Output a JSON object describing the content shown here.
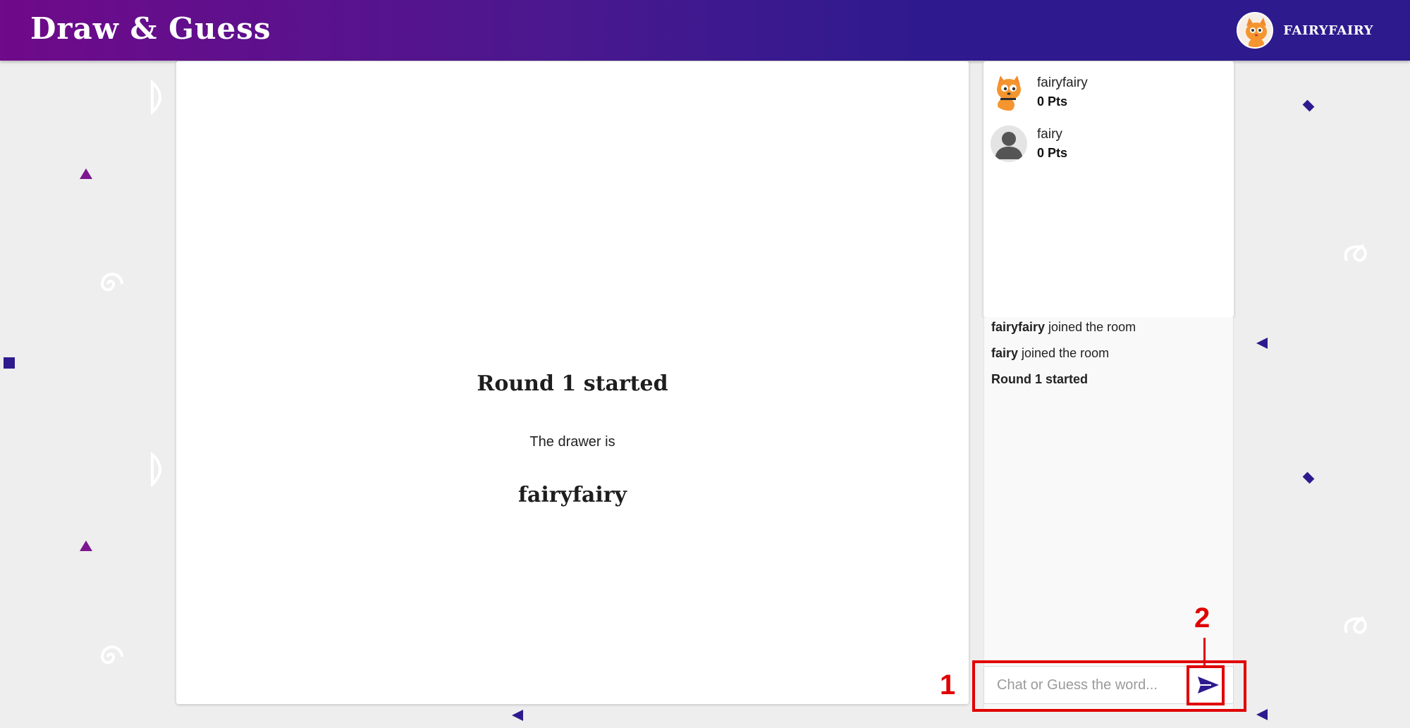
{
  "app": {
    "title": "Draw & Guess",
    "current_user": "FAIRYFAIRY"
  },
  "canvas": {
    "round_title": "Round 1 started",
    "drawer_label": "The drawer is",
    "drawer_name": "fairyfairy"
  },
  "players": [
    {
      "name": "fairyfairy",
      "points": "0 Pts",
      "avatar": "cat-avatar-icon"
    },
    {
      "name": "fairy",
      "points": "0 Pts",
      "avatar": "default-user-icon"
    }
  ],
  "chat": {
    "messages": [
      {
        "bold": "fairyfairy",
        "text": " joined the room"
      },
      {
        "bold": "fairy",
        "text": " joined the room"
      },
      {
        "bold": "Round 1 started",
        "text": ""
      }
    ],
    "input_placeholder": "Chat or Guess the word...",
    "send_icon": "send-icon"
  },
  "annotations": {
    "label_1": "1",
    "label_2": "2",
    "color": "#e00000"
  },
  "colors": {
    "header_start": "#6f0a8a",
    "header_end": "#2d1a8d",
    "accent": "#2e1a8e"
  }
}
